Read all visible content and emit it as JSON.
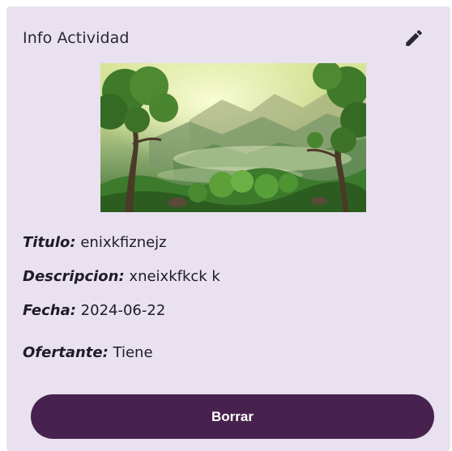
{
  "card": {
    "title": "Info Actividad",
    "edit_icon": "pencil-icon",
    "image_alt": "landscape"
  },
  "fields": [
    {
      "label": "Titulo:",
      "value": "enixkfiznejz"
    },
    {
      "label": "Descripcion:",
      "value": "xneixkfkck k"
    },
    {
      "label": "Fecha:",
      "value": "2024-06-22"
    },
    {
      "label": "Ofertante:",
      "value": "Tiene"
    }
  ],
  "actions": {
    "delete_label": "Borrar"
  },
  "colors": {
    "card_bg": "#e9e1f0",
    "button_bg": "#48224e",
    "text": "#1f1b24"
  }
}
